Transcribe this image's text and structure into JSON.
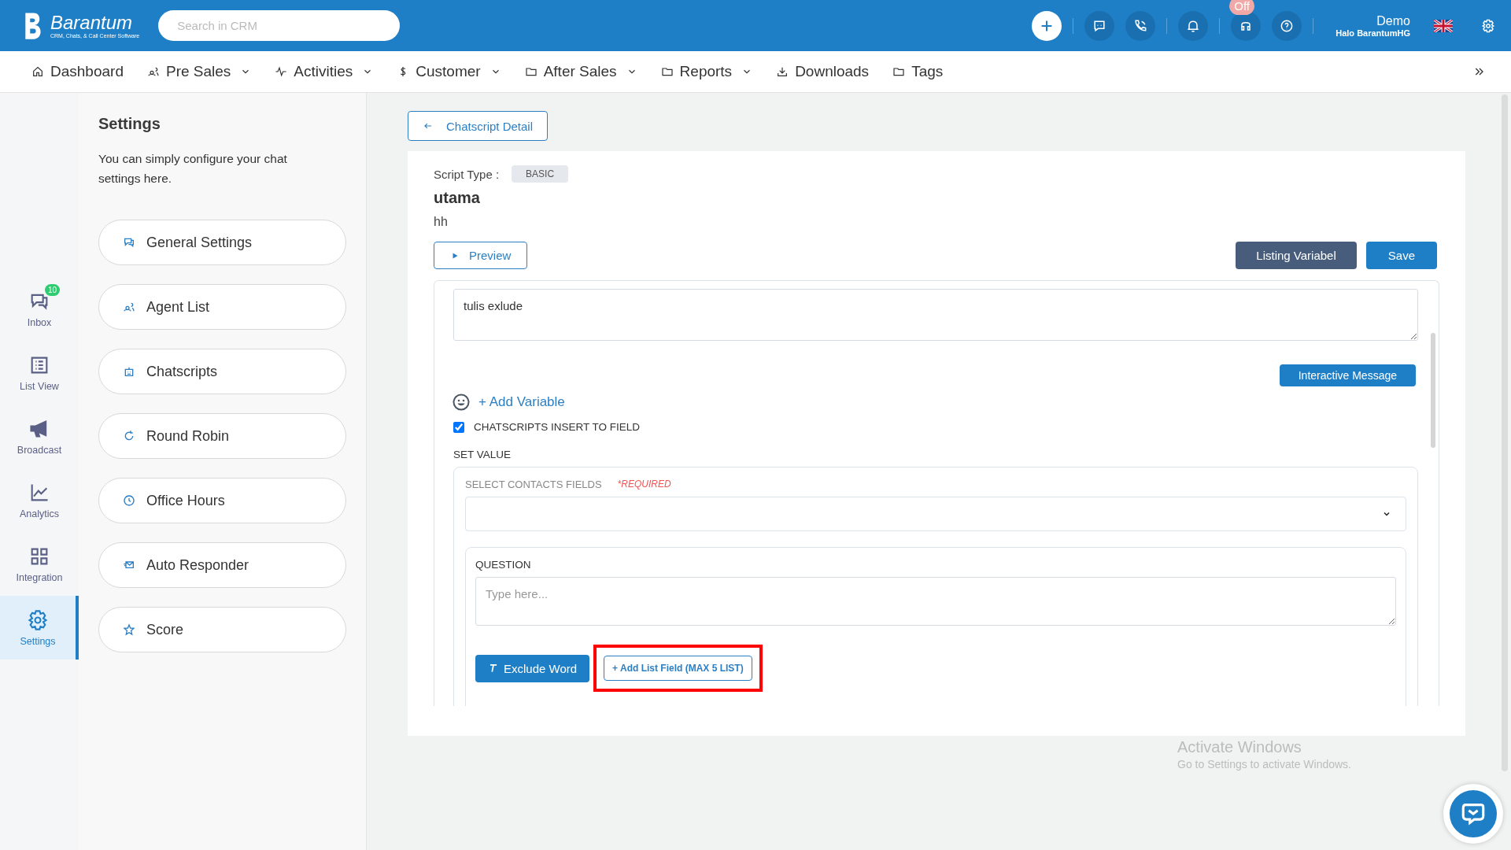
{
  "topbar": {
    "logo": {
      "name": "Barantum",
      "tagline": "CRM, Chats, & Call Center Software"
    },
    "search": {
      "placeholder": "Search in CRM"
    },
    "status_badge": "Off",
    "user": {
      "name": "Demo",
      "company": "Halo BarantumHG"
    }
  },
  "nav": [
    {
      "label": "Dashboard",
      "dropdown": false
    },
    {
      "label": "Pre Sales",
      "dropdown": true
    },
    {
      "label": "Activities",
      "dropdown": true
    },
    {
      "label": "Customer",
      "dropdown": true
    },
    {
      "label": "After Sales",
      "dropdown": true
    },
    {
      "label": "Reports",
      "dropdown": true
    },
    {
      "label": "Downloads",
      "dropdown": false
    },
    {
      "label": "Tags",
      "dropdown": false
    }
  ],
  "rail": [
    {
      "label": "Inbox",
      "badge": "10",
      "selected": false
    },
    {
      "label": "List View",
      "selected": false
    },
    {
      "label": "Broadcast",
      "selected": false
    },
    {
      "label": "Analytics",
      "selected": false
    },
    {
      "label": "Integration",
      "selected": false
    },
    {
      "label": "Settings",
      "selected": true
    }
  ],
  "settings": {
    "title": "Settings",
    "description": "You can simply configure your chat settings here.",
    "items": [
      {
        "label": "General Settings"
      },
      {
        "label": "Agent List"
      },
      {
        "label": "Chatscripts"
      },
      {
        "label": "Round Robin"
      },
      {
        "label": "Office Hours"
      },
      {
        "label": "Auto Responder"
      },
      {
        "label": "Score"
      }
    ]
  },
  "back_button": "Chatscript Detail",
  "script": {
    "type_label": "Script Type :",
    "type": "BASIC",
    "name": "utama",
    "description": "hh"
  },
  "buttons": {
    "preview": "Preview",
    "listing": "Listing Variabel",
    "save": "Save"
  },
  "content": {
    "value": "tulis exlude",
    "interactive_button": "Interactive Message",
    "add_variable": "+ Add Variable"
  },
  "insert_to_field": {
    "label": "CHATSCRIPTS INSERT TO FIELD",
    "checked": true
  },
  "set_value": {
    "title": "SET VALUE",
    "select_label": "SELECT CONTACTS FIELDS",
    "required": "*REQUIRED",
    "question_label": "QUESTION",
    "question_placeholder": "Type here...",
    "exclude_button": "Exclude Word",
    "add_list_button": "+ Add List Field (MAX 5 LIST)",
    "highlighted": true
  },
  "os_notice": {
    "title": "Activate Windows",
    "text": "Go to Settings to activate Windows."
  }
}
